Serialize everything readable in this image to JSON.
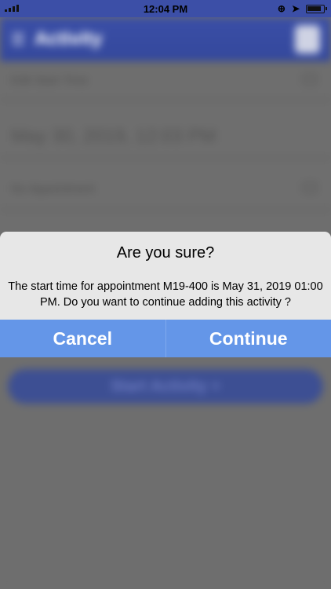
{
  "status_bar": {
    "time": "12:04 PM"
  },
  "background": {
    "header_title": "Activity",
    "start_time_label": "Edit Start Time",
    "start_time_value": "May 30, 2019, 12:03 PM",
    "appointment_label": "No Appointment",
    "start_button_label": "Start Activity +"
  },
  "dialog": {
    "title": "Are you sure?",
    "message": "The start time for appointment M19-400 is May 31, 2019 01:00 PM. Do you want to continue adding this activity ?",
    "cancel_label": "Cancel",
    "continue_label": "Continue"
  },
  "colors": {
    "header": "#3a4ea6",
    "dialog_button_bg": "#6496e8",
    "dialog_bg": "#e7e7e7"
  }
}
